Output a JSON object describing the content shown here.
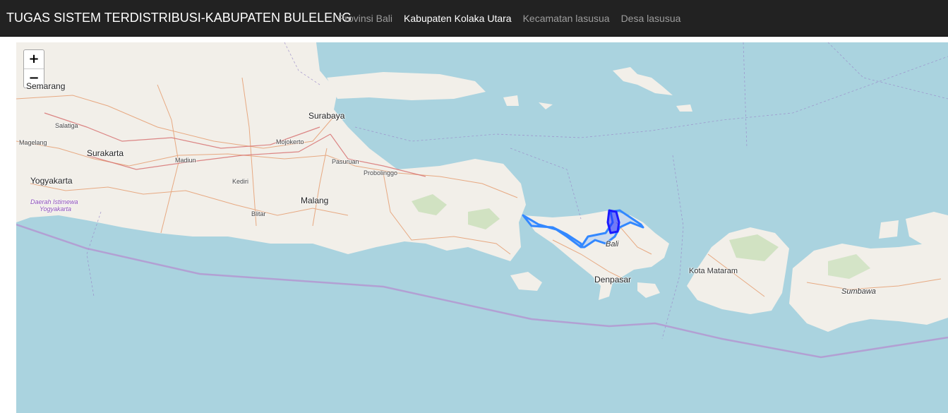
{
  "header": {
    "brand": "TUGAS SISTEM TERDISTRIBUSI-KABUPATEN BULELENG",
    "nav": [
      {
        "label": "Provinsi Bali",
        "active": false
      },
      {
        "label": "Kabupaten Kolaka Utara",
        "active": true
      },
      {
        "label": "Kecamatan lasusua",
        "active": false
      },
      {
        "label": "Desa lasusua",
        "active": false
      }
    ]
  },
  "map": {
    "zoom_in": "+",
    "zoom_out": "−",
    "colors": {
      "sea": "#aad3df",
      "land": "#f2efe9",
      "highlight": "#3388ff",
      "selected": "#1a1aff"
    },
    "labels": {
      "semarang": "Semarang",
      "salatiga": "Salatiga",
      "magelang": "Magelang",
      "surakarta": "Surakarta",
      "madiun": "Madiun",
      "yogyakarta": "Yogyakarta",
      "diy": "Daerah Istimewa",
      "diy2": "Yogyakarta",
      "surabaya": "Surabaya",
      "mojokerto": "Mojokerto",
      "pasuruan": "Pasuruan",
      "probolinggo": "Probolinggo",
      "kediri": "Kediri",
      "malang": "Malang",
      "blitar": "Blitar",
      "bali": "Bali",
      "denpasar": "Denpasar",
      "mataram": "Kota Mataram",
      "sumbawa": "Sumbawa"
    }
  }
}
